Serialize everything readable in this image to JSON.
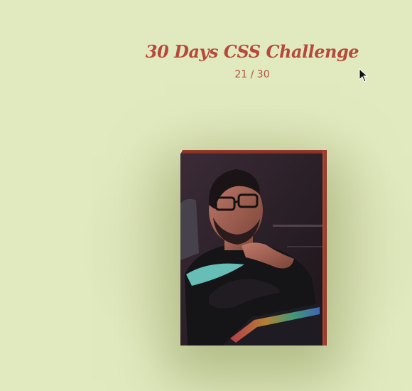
{
  "header": {
    "title": "30 Days CSS Challenge",
    "counter": "21 / 30"
  },
  "book": {
    "photo_description": "portrait-photo",
    "edge_color": "#a8402f",
    "spine_color": "#b04a37"
  },
  "colors": {
    "background": "#e1e9bf",
    "title": "#b54a3a"
  }
}
